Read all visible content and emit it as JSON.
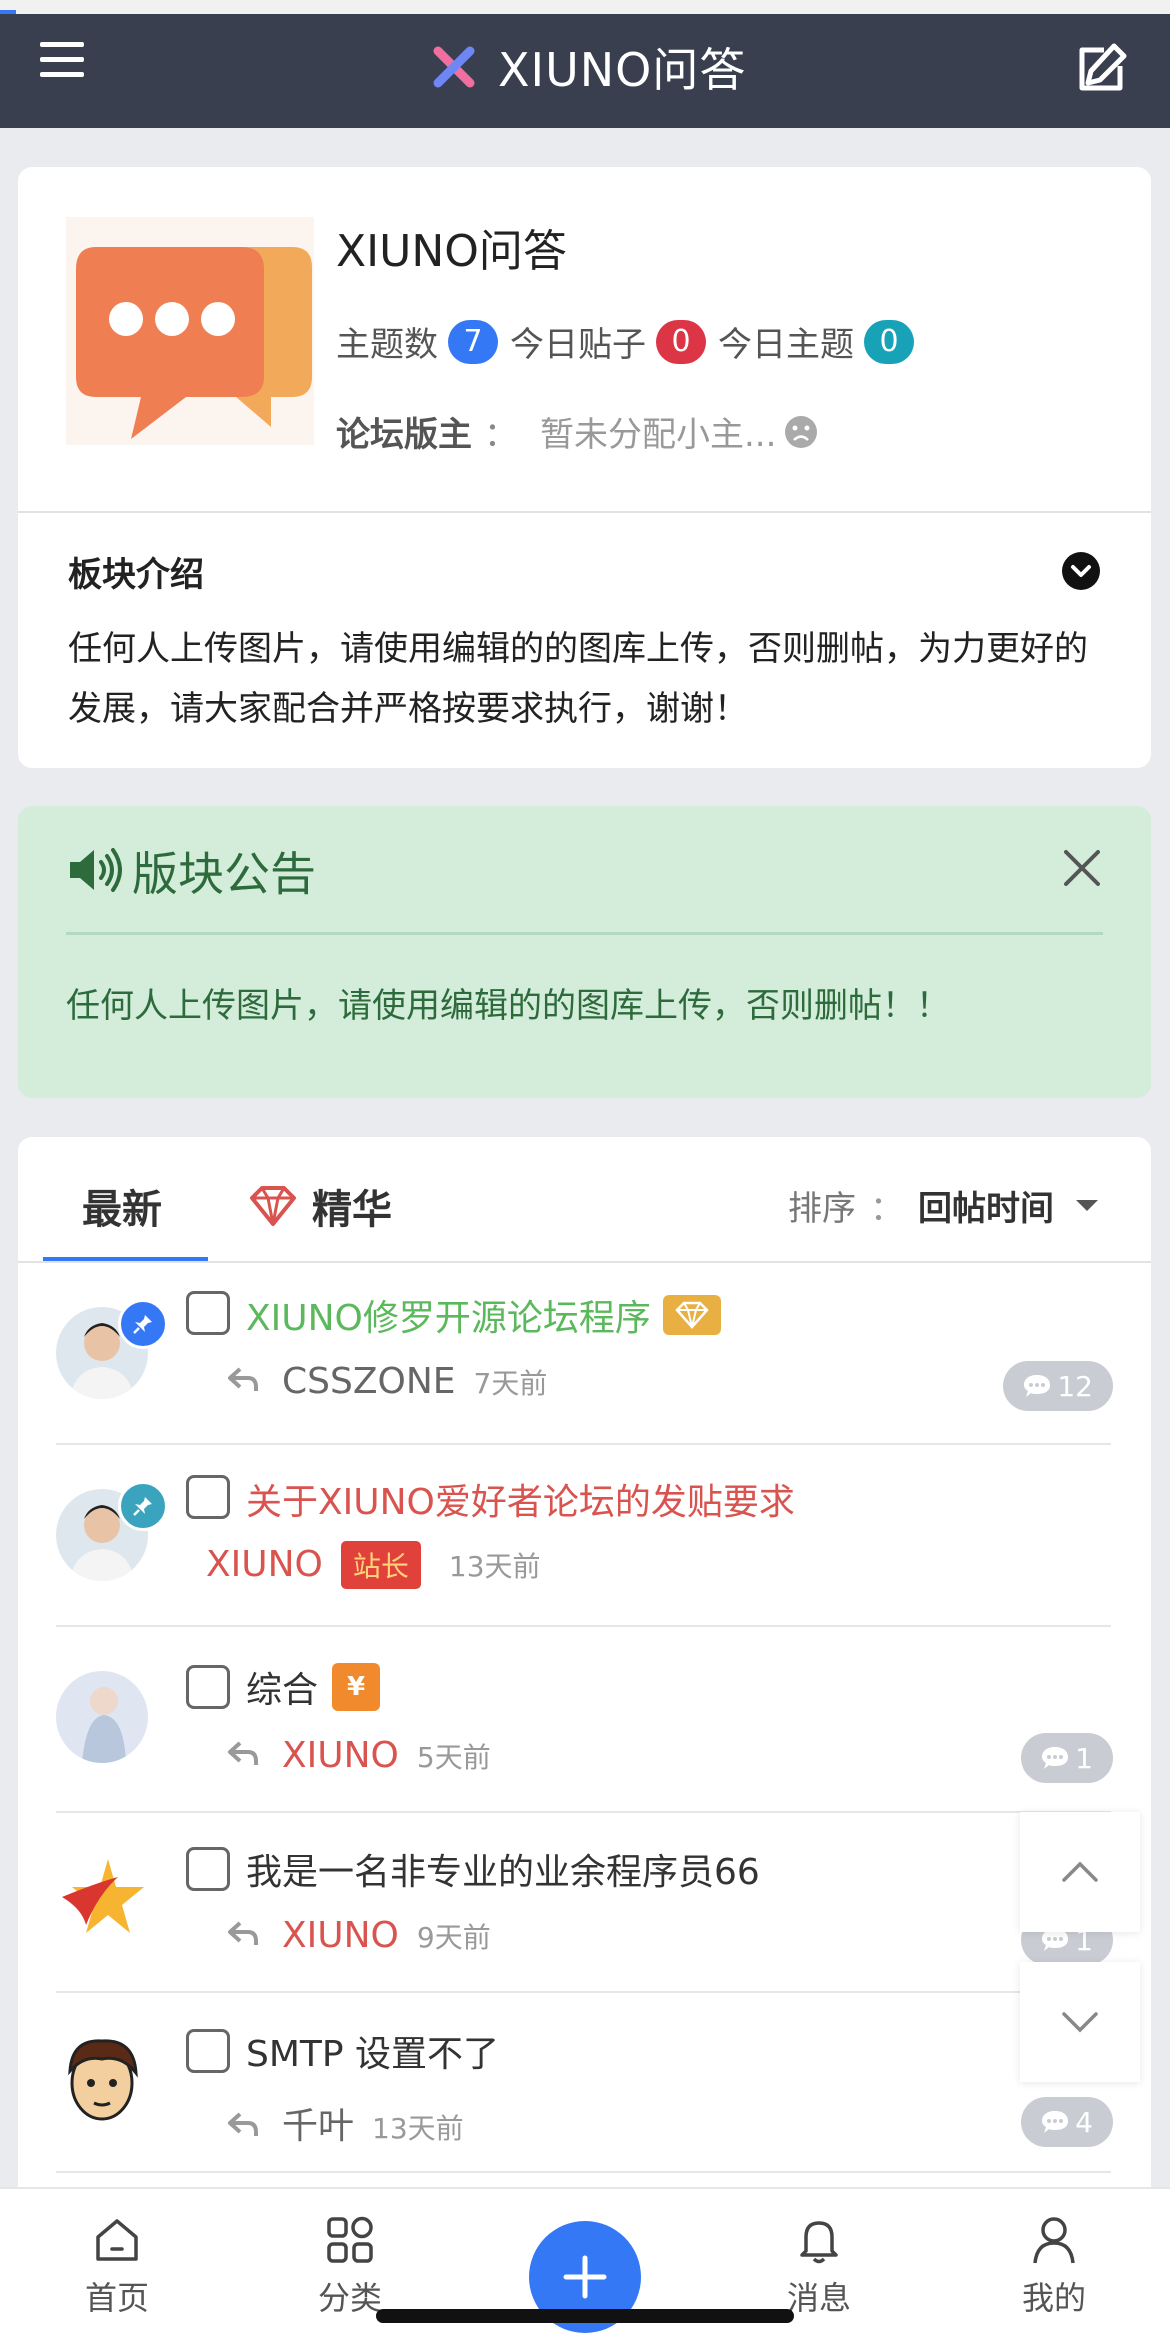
{
  "header": {
    "title": "XIUNO问答",
    "menu_icon": "hamburger-menu-icon",
    "compose_icon": "edit-icon"
  },
  "forum": {
    "name": "XIUNO问答",
    "threads_label": "主题数",
    "threads_count": "7",
    "today_posts_label": "今日贴子",
    "today_posts_count": "0",
    "today_threads_label": "今日主题",
    "today_threads_count": "0",
    "moderator_label": "论坛版主",
    "moderator_colon": "：",
    "moderator_value": "暂未分配小主...",
    "intro_title": "板块介绍",
    "intro_text": "任何人上传图片，请使用编辑的的图库上传，否则删帖，为力更好的发展，请大家配合并严格按要求执行，谢谢！"
  },
  "notice": {
    "title": "版块公告",
    "text": "任何人上传图片，请使用编辑的的图库上传，否则删帖！！"
  },
  "tabs": {
    "latest": "最新",
    "elite": "精华",
    "sort_label": "排序",
    "sort_colon": "：",
    "sort_value": "回帖时间"
  },
  "threads": [
    {
      "title": "XIUNO修罗开源论坛程序",
      "author": "CSSZONE",
      "time": "7天前",
      "replies": "12",
      "title_color": "#5cb85c",
      "author_color": "#666666"
    },
    {
      "title": "关于XIUNO爱好者论坛的发贴要求",
      "author": "XIUNO",
      "role": "站长",
      "time": "13天前",
      "title_color": "#d9534f",
      "author_color": "#d9534f"
    },
    {
      "title": "综合",
      "author": "XIUNO",
      "time": "5天前",
      "replies": "1",
      "yuan": "¥",
      "title_color": "#333333",
      "author_color": "#d9534f"
    },
    {
      "title": "我是一名非专业的业余程序员66",
      "author": "XIUNO",
      "time": "9天前",
      "replies": "1",
      "title_color": "#333333",
      "author_color": "#d9534f"
    },
    {
      "title": "SMTP 设置不了",
      "author": "千叶",
      "time": "13天前",
      "replies": "4",
      "title_color": "#333333",
      "author_color": "#666666"
    }
  ],
  "bottom_nav": {
    "home": "首页",
    "category": "分类",
    "messages": "消息",
    "mine": "我的"
  },
  "colors": {
    "header_bg": "#3a3f4f",
    "accent": "#3478f6",
    "notice_bg": "#d4eddb",
    "notice_text": "#2d6b3c"
  }
}
